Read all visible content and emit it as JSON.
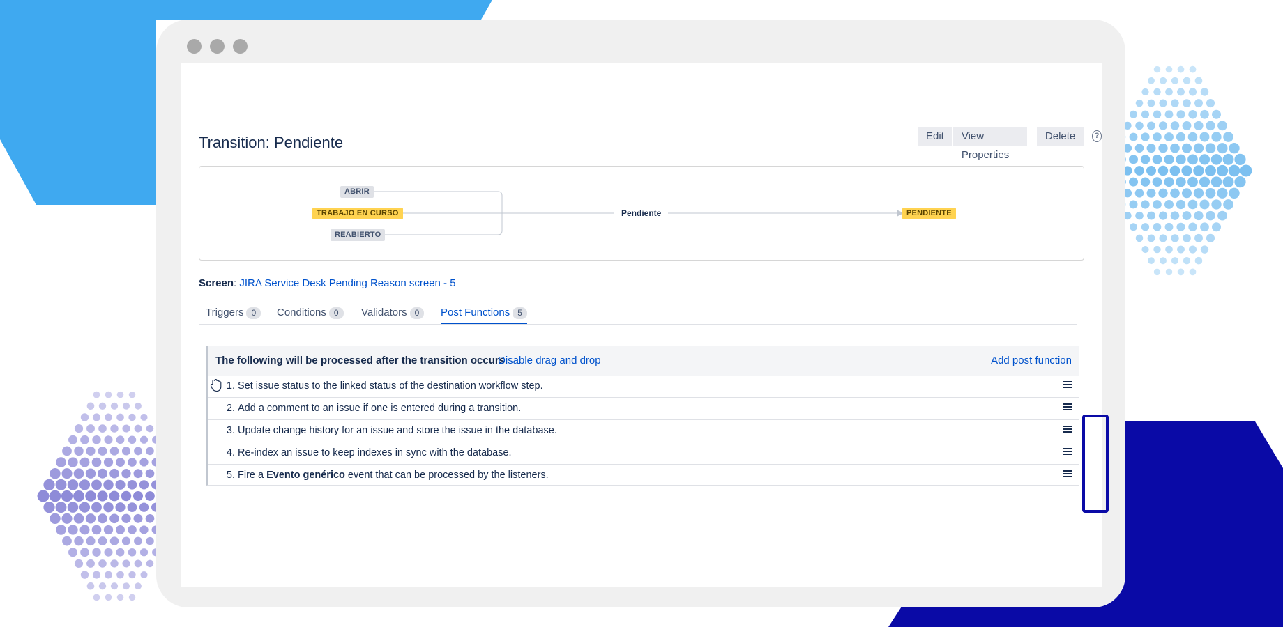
{
  "colors": {
    "bg_light_blue": "#3fa9f0",
    "bg_dark_blue": "#0a0aa6",
    "dots_light_blue": "#a5d3f5",
    "dots_purple": "#8e8bd8",
    "link": "#0052cc",
    "highlight": "#0a0aa6",
    "status_yellow": "#ffd351"
  },
  "page": {
    "title": "Transition: Pendiente",
    "actions": {
      "edit": "Edit",
      "view_properties": "View Properties",
      "delete": "Delete",
      "help_icon": "question-circle-icon"
    }
  },
  "diagram": {
    "from_statuses": [
      "ABRIR",
      "TRABAJO EN CURSO",
      "REABIERTO"
    ],
    "transition_name": "Pendiente",
    "to_status": "PENDIENTE"
  },
  "screen": {
    "label": "Screen",
    "separator": ": ",
    "value": "JIRA Service Desk Pending Reason screen - 5"
  },
  "tabs": [
    {
      "label": "Triggers",
      "count": "0"
    },
    {
      "label": "Conditions",
      "count": "0"
    },
    {
      "label": "Validators",
      "count": "0"
    },
    {
      "label": "Post Functions",
      "count": "5",
      "active": true
    }
  ],
  "post_functions": {
    "header_title": "The following will be processed after the transition occurs",
    "disable_drag_label": "Disable drag and drop",
    "add_label": "Add post function",
    "items": [
      {
        "num": "1.",
        "text": "Set issue status to the linked status of the destination workflow step."
      },
      {
        "num": "2.",
        "text": "Add a comment to an issue if one is entered during a transition."
      },
      {
        "num": "3.",
        "text": "Update change history for an issue and store the issue in the database."
      },
      {
        "num": "4.",
        "text": "Re-index an issue to keep indexes in sync with the database."
      },
      {
        "num": "5.",
        "text_before": "Fire a ",
        "text_bold": "Evento genérico",
        "text_after": " event that can be processed by the listeners."
      }
    ],
    "row_menu_icon": "hamburger-menu-icon",
    "drag_icon": "grab-hand-icon"
  }
}
